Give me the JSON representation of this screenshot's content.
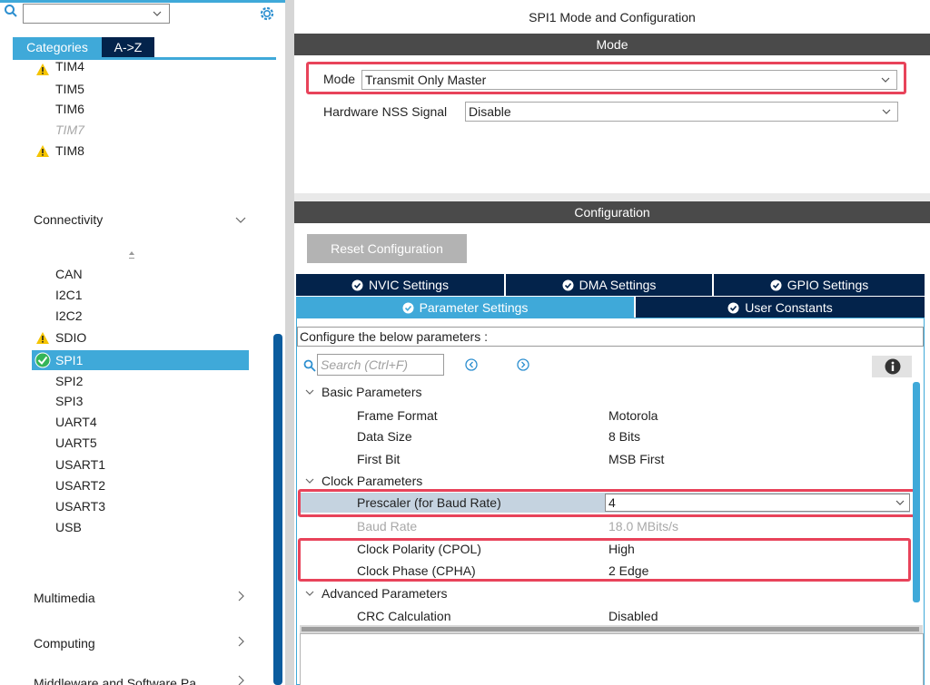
{
  "left_panel": {
    "tabs": {
      "categories": "Categories",
      "az": "A->Z"
    },
    "timers_items": [
      {
        "label": "TIM4",
        "warn": true,
        "disabled": false
      },
      {
        "label": "TIM5",
        "warn": false,
        "disabled": false
      },
      {
        "label": "TIM6",
        "warn": false,
        "disabled": false
      },
      {
        "label": "TIM7",
        "warn": false,
        "disabled": true
      },
      {
        "label": "TIM8",
        "warn": true,
        "disabled": false
      }
    ],
    "categories": {
      "connectivity": "Connectivity",
      "multimedia": "Multimedia",
      "computing": "Computing",
      "middleware": "Middleware and Software Pa..."
    },
    "connectivity_items": [
      {
        "label": "CAN"
      },
      {
        "label": "I2C1"
      },
      {
        "label": "I2C2"
      },
      {
        "label": "SDIO",
        "warn": true
      },
      {
        "label": "SPI1",
        "ok": true,
        "selected": true
      },
      {
        "label": "SPI2"
      },
      {
        "label": "SPI3"
      },
      {
        "label": "UART4"
      },
      {
        "label": "UART5"
      },
      {
        "label": "USART1"
      },
      {
        "label": "USART2"
      },
      {
        "label": "USART3"
      },
      {
        "label": "USB"
      }
    ]
  },
  "right_panel": {
    "title": "SPI1 Mode and Configuration",
    "mode_header": "Mode",
    "mode_label": "Mode",
    "mode_value": "Transmit Only Master",
    "nss_label": "Hardware NSS Signal",
    "nss_value": "Disable",
    "config_header": "Configuration",
    "reset_button": "Reset Configuration",
    "tabs": {
      "nvic": "NVIC Settings",
      "dma": "DMA Settings",
      "gpio": "GPIO Settings",
      "parameter": "Parameter Settings",
      "user_constants": "User Constants"
    },
    "param_description": "Configure the below parameters :",
    "search_placeholder": "Search (Ctrl+F)",
    "groups": {
      "basic": "Basic Parameters",
      "clock": "Clock Parameters",
      "advanced": "Advanced Parameters"
    },
    "params": {
      "frame_format": {
        "name": "Frame Format",
        "value": "Motorola"
      },
      "data_size": {
        "name": "Data Size",
        "value": "8 Bits"
      },
      "first_bit": {
        "name": "First Bit",
        "value": "MSB First"
      },
      "prescaler": {
        "name": "Prescaler (for Baud Rate)",
        "value": "4"
      },
      "baud_rate": {
        "name": "Baud Rate",
        "value": "18.0 MBits/s"
      },
      "cpol": {
        "name": "Clock Polarity (CPOL)",
        "value": "High"
      },
      "cpha": {
        "name": "Clock Phase (CPHA)",
        "value": "2 Edge"
      },
      "crc": {
        "name": "CRC Calculation",
        "value": "Disabled"
      }
    }
  },
  "colors": {
    "accent": "#3fa9d9",
    "navy": "#03234b",
    "highlight": "#e8435a",
    "header_gray": "#4a4a4a",
    "ok_green": "#34b558",
    "warn_yellow": "#f5c400"
  }
}
